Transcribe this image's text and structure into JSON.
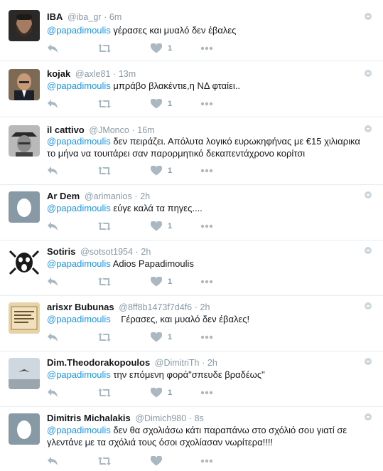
{
  "icons": {
    "reply": "reply-icon",
    "retweet": "retweet-icon",
    "like": "heart-icon",
    "more": "more-dots-icon",
    "caret": "caret-down-icon"
  },
  "colors": {
    "mention": "#1b95e0",
    "meta": "#8899a6",
    "icon": "#aab8c2",
    "divider": "#e6ecf0"
  },
  "tweets": [
    {
      "name": "IBA",
      "handle": "@iba_gr",
      "dot": "·",
      "time": "6m",
      "mention": "@papadimoulis",
      "text": " γέρασες και μυαλό δεν έβαλες",
      "likes": "1",
      "avatar": "bearded-man-avatar"
    },
    {
      "name": "kojak",
      "handle": "@axle81",
      "dot": "·",
      "time": "13m",
      "mention": "@papadimoulis",
      "text": " μπράβο βλακέντιε,η ΝΔ φταίει..",
      "likes": "1",
      "avatar": "bald-man-suit-avatar"
    },
    {
      "name": "il cattivo",
      "handle": "@JMonco",
      "dot": "·",
      "time": "16m",
      "mention": "@papadimoulis",
      "text": " δεν πειράζει. Απόλυτα λογικό ευρωκηφήνας με €15 χιλιαρικα το μήνα να τουιτάρει σαν παρορμητικό δεκαπεντάχρονο κορίτσι",
      "likes": "1",
      "avatar": "cowboy-portrait-avatar"
    },
    {
      "name": "Ar Dem",
      "handle": "@arimanios",
      "dot": "·",
      "time": "2h",
      "mention": "@papadimoulis",
      "text": " εύγε καλά τα πηγες....",
      "likes": "1",
      "avatar": "default-egg-avatar"
    },
    {
      "name": "Sotiris",
      "handle": "@sotsot1954",
      "dot": "·",
      "time": "2h",
      "mention": "@papadimoulis",
      "text": " Adios Papadimoulis",
      "likes": "1",
      "avatar": "screaming-face-avatar"
    },
    {
      "name": "arisxr Bubunas",
      "handle": "@8ff8b1473f7d4f6",
      "dot": "·",
      "time": "2h",
      "mention": "@papadimoulis",
      "text": "    Γέρασες, και μυαλό δεν έβαλες!",
      "likes": "1",
      "avatar": "parchment-text-avatar"
    },
    {
      "name": "Dim.Theodorakopoulos",
      "handle": "@DimitriTh",
      "dot": "·",
      "time": "2h",
      "mention": "@papadimoulis",
      "text": " την επόμενη φορά\"σπευδε βραδέως\"",
      "likes": "1",
      "avatar": "bird-sky-avatar"
    },
    {
      "name": "Dimitris Michalakis",
      "handle": "@Dimich980",
      "dot": "·",
      "time": "8s",
      "mention": "@papadimoulis",
      "text": " δεν θα σχολιάσω κάτι παραπάνω στο σχόλιό σου γιατί σε γλεντάνε με τα σχόλιά τους όσοι σχολίασαν νωρίτερα!!!!",
      "likes": "",
      "avatar": "default-egg-avatar"
    }
  ]
}
